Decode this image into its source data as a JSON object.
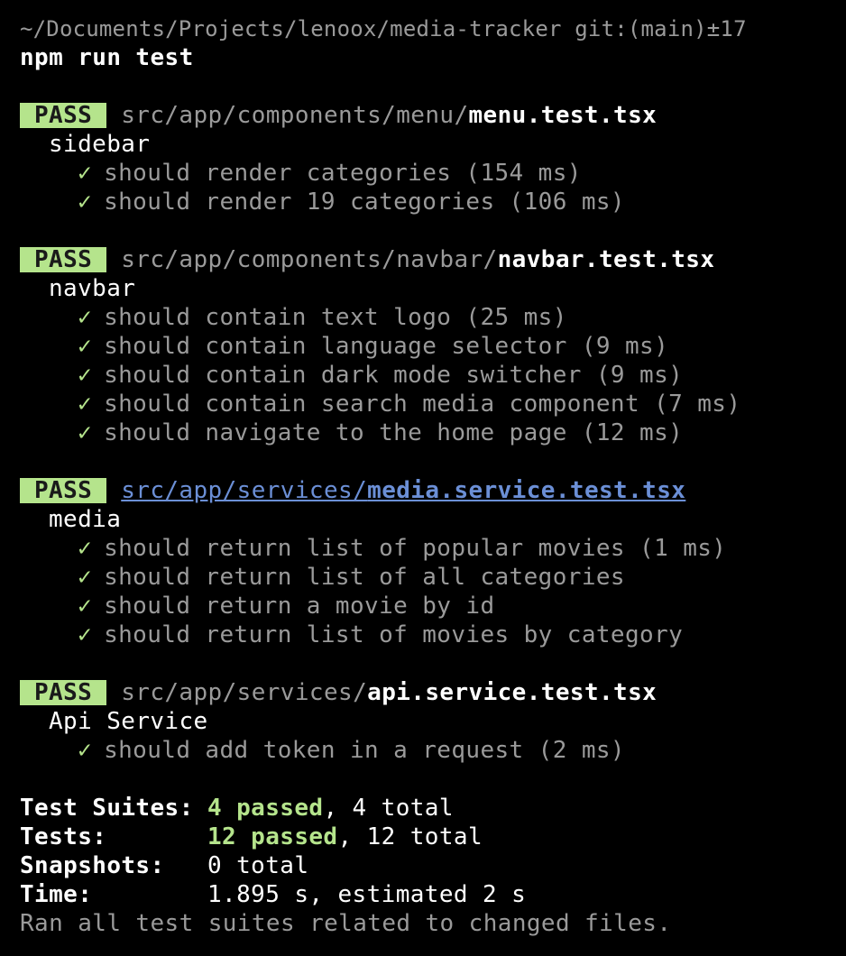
{
  "prompt": {
    "path": "~/Documents/Projects/lenoox/media-tracker",
    "git": "git:(main)±17"
  },
  "command": "npm run test",
  "badge_label": "PASS",
  "suites": [
    {
      "dir": "src/app/components/menu/",
      "file": "menu.test.tsx",
      "link": false,
      "group": "sidebar",
      "tests": [
        "should render categories (154 ms)",
        "should render 19 categories (106 ms)"
      ]
    },
    {
      "dir": "src/app/components/navbar/",
      "file": "navbar.test.tsx",
      "link": false,
      "group": "navbar",
      "tests": [
        "should contain text logo (25 ms)",
        "should contain language selector (9 ms)",
        "should contain dark mode switcher (9 ms)",
        "should contain search media component (7 ms)",
        "should navigate to the home page (12 ms)"
      ]
    },
    {
      "dir": "src/app/services/",
      "file": "media.service.test.tsx",
      "link": true,
      "group": "media",
      "tests": [
        "should return list of popular movies (1 ms)",
        "should return list of all categories",
        "should return a movie by id",
        "should return list of movies by category"
      ]
    },
    {
      "dir": "src/app/services/",
      "file": "api.service.test.tsx",
      "link": false,
      "group": "Api Service",
      "tests": [
        "should add token in a request (2 ms)"
      ]
    }
  ],
  "check_glyph": "✓",
  "summary": {
    "suites_label": "Test Suites:",
    "suites_passed": "4 passed",
    "suites_total": ", 4 total",
    "tests_label": "Tests:",
    "tests_passed": "12 passed",
    "tests_total": ", 12 total",
    "snapshots_label": "Snapshots:",
    "snapshots_value": "0 total",
    "time_label": "Time:",
    "time_value": "1.895 s, estimated 2 s",
    "footer": "Ran all test suites related to changed files."
  },
  "colors": {
    "background": "#000000",
    "pass_badge": "#b5e48c",
    "link": "#6b8fd6",
    "dim_text": "#9a9a9a"
  }
}
